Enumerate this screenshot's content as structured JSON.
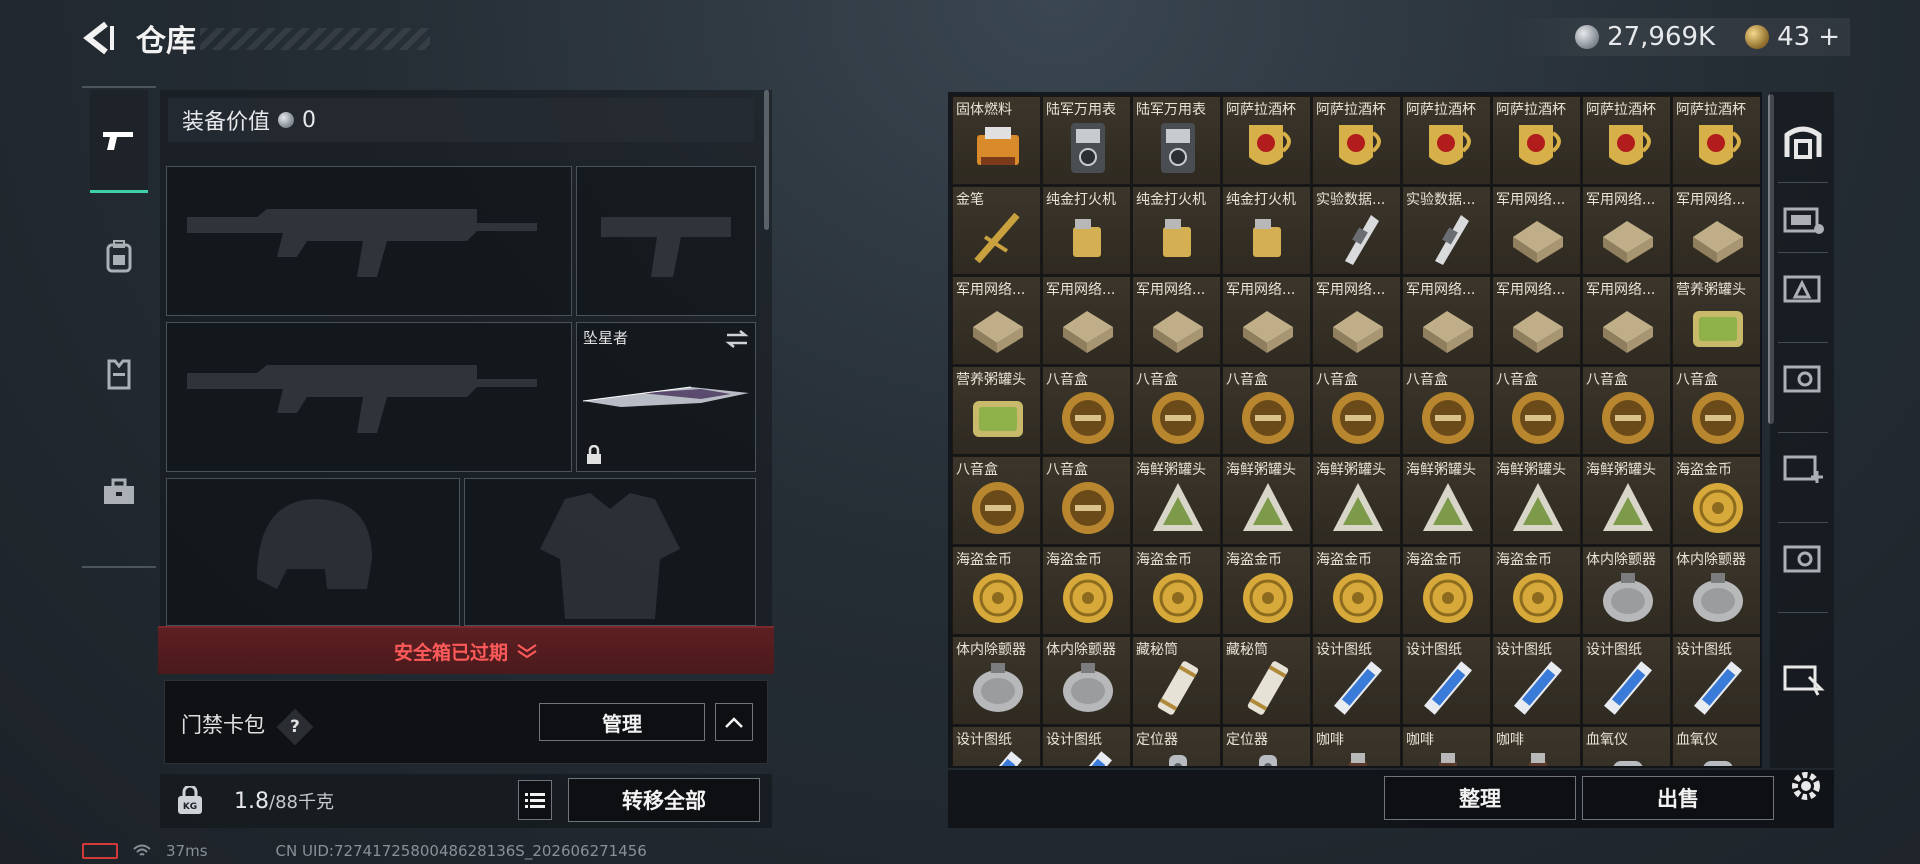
{
  "header": {
    "title": "仓库",
    "silver": "27,969K",
    "gold": "43",
    "gold_plus": "+"
  },
  "loadout": {
    "equip_value_label": "装备价值",
    "equip_value": "0",
    "melee_name": "坠星者",
    "safe_box_status": "安全箱已过期",
    "access_card_label": "门禁卡包",
    "access_help": "?",
    "manage_label": "管理",
    "weight_current": "1.8",
    "weight_max": "/88千克",
    "transfer_all": "转移全部"
  },
  "stash": {
    "items": [
      "固体燃料",
      "陆军万用表",
      "陆军万用表",
      "阿萨拉酒杯",
      "阿萨拉酒杯",
      "阿萨拉酒杯",
      "阿萨拉酒杯",
      "阿萨拉酒杯",
      "阿萨拉酒杯",
      "金笔",
      "纯金打火机",
      "纯金打火机",
      "纯金打火机",
      "实验数据...",
      "实验数据...",
      "军用网络...",
      "军用网络...",
      "军用网络...",
      "军用网络...",
      "军用网络...",
      "军用网络...",
      "军用网络...",
      "军用网络...",
      "军用网络...",
      "军用网络...",
      "军用网络...",
      "营养粥罐头",
      "营养粥罐头",
      "八音盒",
      "八音盒",
      "八音盒",
      "八音盒",
      "八音盒",
      "八音盒",
      "八音盒",
      "八音盒",
      "八音盒",
      "八音盒",
      "海鲜粥罐头",
      "海鲜粥罐头",
      "海鲜粥罐头",
      "海鲜粥罐头",
      "海鲜粥罐头",
      "海鲜粥罐头",
      "海盗金币",
      "海盗金币",
      "海盗金币",
      "海盗金币",
      "海盗金币",
      "海盗金币",
      "海盗金币",
      "海盗金币",
      "体内除颤器",
      "体内除颤器",
      "体内除颤器",
      "体内除颤器",
      "藏秘筒",
      "藏秘筒",
      "设计图纸",
      "设计图纸",
      "设计图纸",
      "设计图纸",
      "设计图纸",
      "设计图纸",
      "设计图纸",
      "定位器",
      "定位器",
      "咖啡",
      "咖啡",
      "咖啡",
      "血氧仪",
      "血氧仪"
    ],
    "sort_label": "整理",
    "sell_label": "出售"
  },
  "status": {
    "ping": "37ms",
    "uid": "CN UID:7274172580048628136S_202606271456"
  },
  "colors": {
    "accent": "#3fd0a8",
    "danger": "#ff5a5a",
    "cell": "#3b352a"
  }
}
